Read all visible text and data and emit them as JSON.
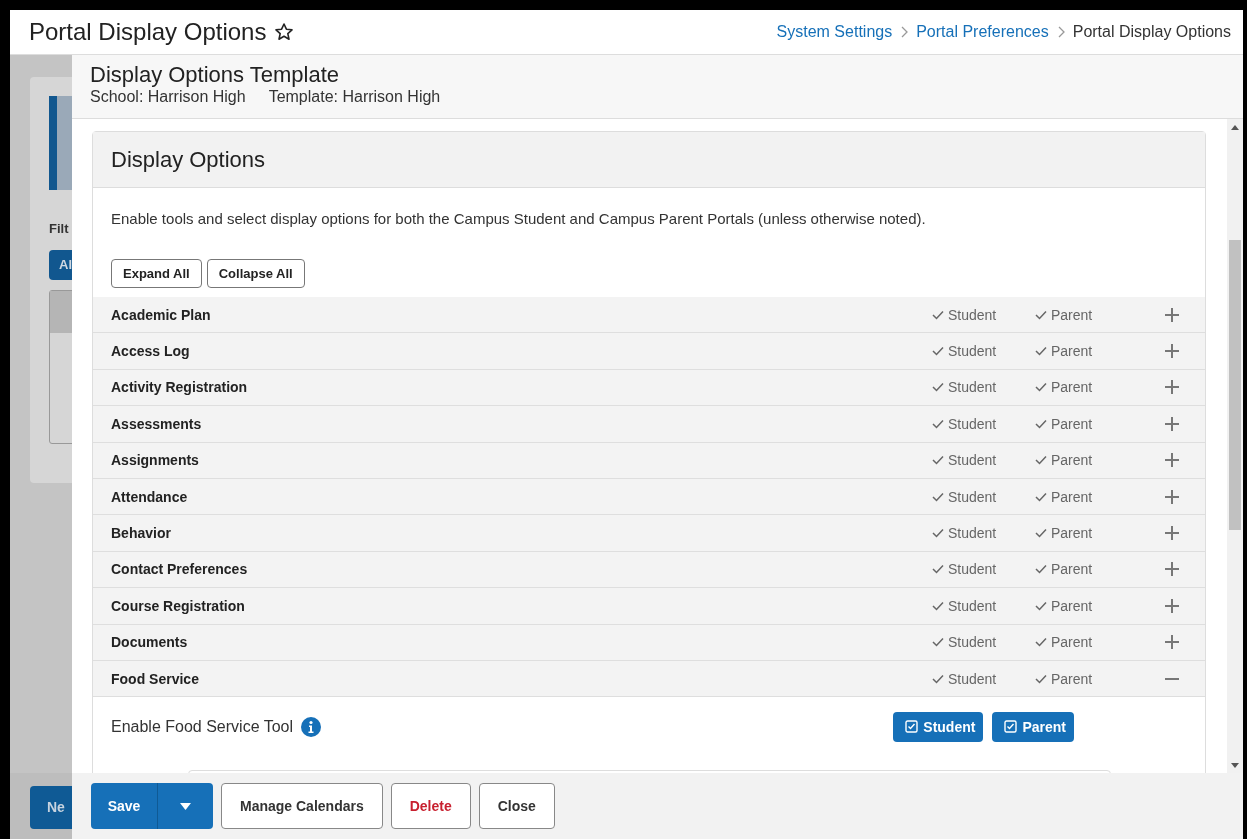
{
  "header": {
    "title": "Portal Display Options",
    "breadcrumbs": [
      "System Settings",
      "Portal Preferences",
      "Portal Display Options"
    ]
  },
  "background_page": {
    "filter_label": "Filt",
    "filter_button": "Al",
    "new_button": "Ne"
  },
  "panel": {
    "title": "Display Options Template",
    "school": "School: Harrison High",
    "template": "Template: Harrison High"
  },
  "card": {
    "title": "Display Options",
    "description": "Enable tools and select display options for both the Campus Student and Campus Parent Portals (unless otherwise noted).",
    "buttons": [
      "Expand All",
      "Collapse All"
    ]
  },
  "options": [
    {
      "name": "Academic Plan",
      "student_label": "Student",
      "student": true,
      "parent_label": "Parent",
      "parent": true,
      "expanded": false
    },
    {
      "name": "Access Log",
      "student_label": "Student",
      "student": true,
      "parent_label": "Parent",
      "parent": true,
      "expanded": false
    },
    {
      "name": "Activity Registration",
      "student_label": "Student",
      "student": true,
      "parent_label": "Parent",
      "parent": true,
      "expanded": false
    },
    {
      "name": "Assessments",
      "student_label": "Student",
      "student": true,
      "parent_label": "Parent",
      "parent": true,
      "expanded": false
    },
    {
      "name": "Assignments",
      "student_label": "Student",
      "student": true,
      "parent_label": "Parent",
      "parent": true,
      "expanded": false
    },
    {
      "name": "Attendance",
      "student_label": "Student",
      "student": true,
      "parent_label": "Parent",
      "parent": true,
      "expanded": false
    },
    {
      "name": "Behavior",
      "student_label": "Student",
      "student": true,
      "parent_label": "Parent",
      "parent": true,
      "expanded": false
    },
    {
      "name": "Contact Preferences",
      "student_label": "Student",
      "student": true,
      "parent_label": "Parent",
      "parent": true,
      "expanded": false
    },
    {
      "name": "Course Registration",
      "student_label": "Student",
      "student": true,
      "parent_label": "Parent",
      "parent": true,
      "expanded": false
    },
    {
      "name": "Documents",
      "student_label": "Student",
      "student": true,
      "parent_label": "Parent",
      "parent": true,
      "expanded": false
    },
    {
      "name": "Food Service",
      "student_label": "Student",
      "student": true,
      "parent_label": "Parent",
      "parent": true,
      "expanded": true
    }
  ],
  "detail": {
    "label": "Enable Food Service Tool",
    "toggles": [
      {
        "label": "Student",
        "checked": true
      },
      {
        "label": "Parent",
        "checked": true
      }
    ]
  },
  "footer": {
    "save": "Save",
    "buttons": [
      {
        "label": "Manage Calendars",
        "kind": "normal"
      },
      {
        "label": "Delete",
        "kind": "danger"
      },
      {
        "label": "Close",
        "kind": "normal"
      }
    ]
  }
}
